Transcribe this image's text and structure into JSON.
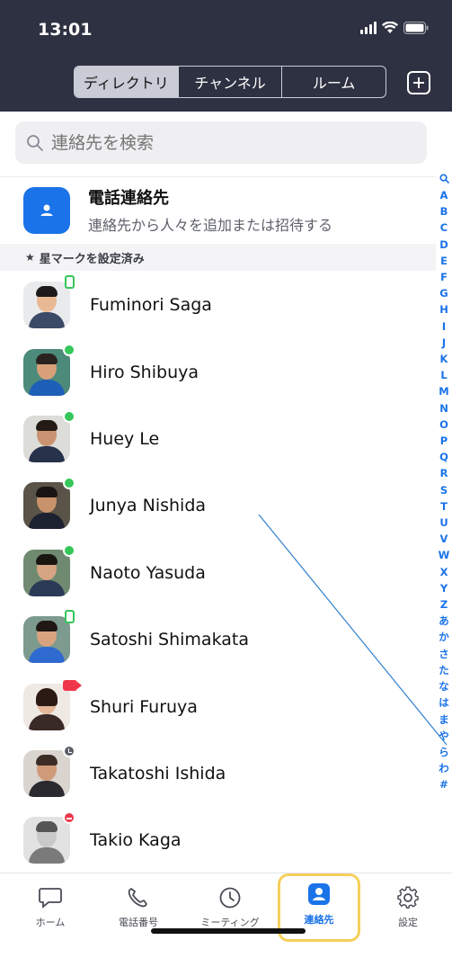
{
  "status": {
    "time": "13:01"
  },
  "header": {
    "tabs": [
      {
        "label": "ディレクトリ"
      },
      {
        "label": "チャンネル"
      },
      {
        "label": "ルーム"
      }
    ]
  },
  "search": {
    "placeholder": "連絡先を検索"
  },
  "phone_contacts": {
    "title": "電話連絡先",
    "subtitle": "連絡先から人々を追加または招待する"
  },
  "starred_section": {
    "label": "星マークを設定済み"
  },
  "contacts": [
    {
      "name": "Fuminori Saga",
      "presence": "mobile"
    },
    {
      "name": "Hiro Shibuya",
      "presence": "available"
    },
    {
      "name": "Huey Le",
      "presence": "available"
    },
    {
      "name": "Junya Nishida",
      "presence": "available"
    },
    {
      "name": "Naoto Yasuda",
      "presence": "available"
    },
    {
      "name": "Satoshi Shimakata",
      "presence": "mobile"
    },
    {
      "name": "Shuri Furuya",
      "presence": "in-meeting"
    },
    {
      "name": "Takatoshi Ishida",
      "presence": "away"
    },
    {
      "name": "Takio Kaga",
      "presence": "do-not-disturb"
    }
  ],
  "alphabet_index": [
    "A",
    "B",
    "C",
    "D",
    "E",
    "F",
    "G",
    "H",
    "I",
    "J",
    "K",
    "L",
    "M",
    "N",
    "O",
    "P",
    "Q",
    "R",
    "S",
    "T",
    "U",
    "V",
    "W",
    "X",
    "Y",
    "Z",
    "あ",
    "か",
    "さ",
    "た",
    "な",
    "は",
    "ま",
    "や",
    "ら",
    "わ",
    "#"
  ],
  "tabbar": {
    "items": [
      {
        "label": "ホーム",
        "icon": "chat-bubble-icon"
      },
      {
        "label": "電話番号",
        "icon": "phone-icon"
      },
      {
        "label": "ミーティング",
        "icon": "clock-icon"
      },
      {
        "label": "連絡先",
        "icon": "contacts-icon"
      },
      {
        "label": "設定",
        "icon": "gear-icon"
      }
    ],
    "active_index": 3
  },
  "colors": {
    "header_bg": "#2e3142",
    "accent": "#1a73e8",
    "highlight": "#f6cf5a",
    "presence_green": "#35c75a",
    "presence_red": "#f0364a"
  }
}
